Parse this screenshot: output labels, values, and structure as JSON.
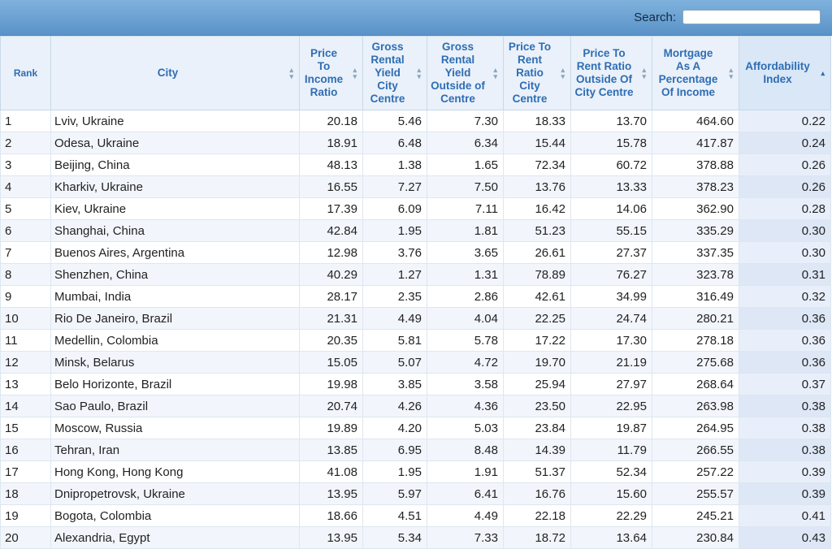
{
  "search": {
    "label": "Search:",
    "value": ""
  },
  "columns": [
    {
      "label": "Rank"
    },
    {
      "label": "City"
    },
    {
      "label": "Price To Income Ratio"
    },
    {
      "label": "Gross Rental Yield City Centre"
    },
    {
      "label": "Gross Rental Yield Outside of Centre"
    },
    {
      "label": "Price To Rent Ratio City Centre"
    },
    {
      "label": "Price To Rent Ratio Outside Of City Centre"
    },
    {
      "label": "Mortgage As A Percentage Of Income"
    },
    {
      "label": "Affordability Index"
    }
  ],
  "sort": {
    "active_column": "Affordability Index",
    "direction": "ascending"
  },
  "colors": {
    "header_text": "#2f6db3",
    "search_bar": "#5a93c9",
    "row_alt": "#f2f6fc",
    "sorted_column": "#dde7f6"
  },
  "icons": {
    "sortable": "sort-arrows-icon",
    "sorted_ascending": "sort-up-icon"
  },
  "rows": [
    [
      "1",
      "Lviv, Ukraine",
      "20.18",
      "5.46",
      "7.30",
      "18.33",
      "13.70",
      "464.60",
      "0.22"
    ],
    [
      "2",
      "Odesa, Ukraine",
      "18.91",
      "6.48",
      "6.34",
      "15.44",
      "15.78",
      "417.87",
      "0.24"
    ],
    [
      "3",
      "Beijing, China",
      "48.13",
      "1.38",
      "1.65",
      "72.34",
      "60.72",
      "378.88",
      "0.26"
    ],
    [
      "4",
      "Kharkiv, Ukraine",
      "16.55",
      "7.27",
      "7.50",
      "13.76",
      "13.33",
      "378.23",
      "0.26"
    ],
    [
      "5",
      "Kiev, Ukraine",
      "17.39",
      "6.09",
      "7.11",
      "16.42",
      "14.06",
      "362.90",
      "0.28"
    ],
    [
      "6",
      "Shanghai, China",
      "42.84",
      "1.95",
      "1.81",
      "51.23",
      "55.15",
      "335.29",
      "0.30"
    ],
    [
      "7",
      "Buenos Aires, Argentina",
      "12.98",
      "3.76",
      "3.65",
      "26.61",
      "27.37",
      "337.35",
      "0.30"
    ],
    [
      "8",
      "Shenzhen, China",
      "40.29",
      "1.27",
      "1.31",
      "78.89",
      "76.27",
      "323.78",
      "0.31"
    ],
    [
      "9",
      "Mumbai, India",
      "28.17",
      "2.35",
      "2.86",
      "42.61",
      "34.99",
      "316.49",
      "0.32"
    ],
    [
      "10",
      "Rio De Janeiro, Brazil",
      "21.31",
      "4.49",
      "4.04",
      "22.25",
      "24.74",
      "280.21",
      "0.36"
    ],
    [
      "11",
      "Medellin, Colombia",
      "20.35",
      "5.81",
      "5.78",
      "17.22",
      "17.30",
      "278.18",
      "0.36"
    ],
    [
      "12",
      "Minsk, Belarus",
      "15.05",
      "5.07",
      "4.72",
      "19.70",
      "21.19",
      "275.68",
      "0.36"
    ],
    [
      "13",
      "Belo Horizonte, Brazil",
      "19.98",
      "3.85",
      "3.58",
      "25.94",
      "27.97",
      "268.64",
      "0.37"
    ],
    [
      "14",
      "Sao Paulo, Brazil",
      "20.74",
      "4.26",
      "4.36",
      "23.50",
      "22.95",
      "263.98",
      "0.38"
    ],
    [
      "15",
      "Moscow, Russia",
      "19.89",
      "4.20",
      "5.03",
      "23.84",
      "19.87",
      "264.95",
      "0.38"
    ],
    [
      "16",
      "Tehran, Iran",
      "13.85",
      "6.95",
      "8.48",
      "14.39",
      "11.79",
      "266.55",
      "0.38"
    ],
    [
      "17",
      "Hong Kong, Hong Kong",
      "41.08",
      "1.95",
      "1.91",
      "51.37",
      "52.34",
      "257.22",
      "0.39"
    ],
    [
      "18",
      "Dnipropetrovsk, Ukraine",
      "13.95",
      "5.97",
      "6.41",
      "16.76",
      "15.60",
      "255.57",
      "0.39"
    ],
    [
      "19",
      "Bogota, Colombia",
      "18.66",
      "4.51",
      "4.49",
      "22.18",
      "22.29",
      "245.21",
      "0.41"
    ],
    [
      "20",
      "Alexandria, Egypt",
      "13.95",
      "5.34",
      "7.33",
      "18.72",
      "13.64",
      "230.84",
      "0.43"
    ]
  ]
}
